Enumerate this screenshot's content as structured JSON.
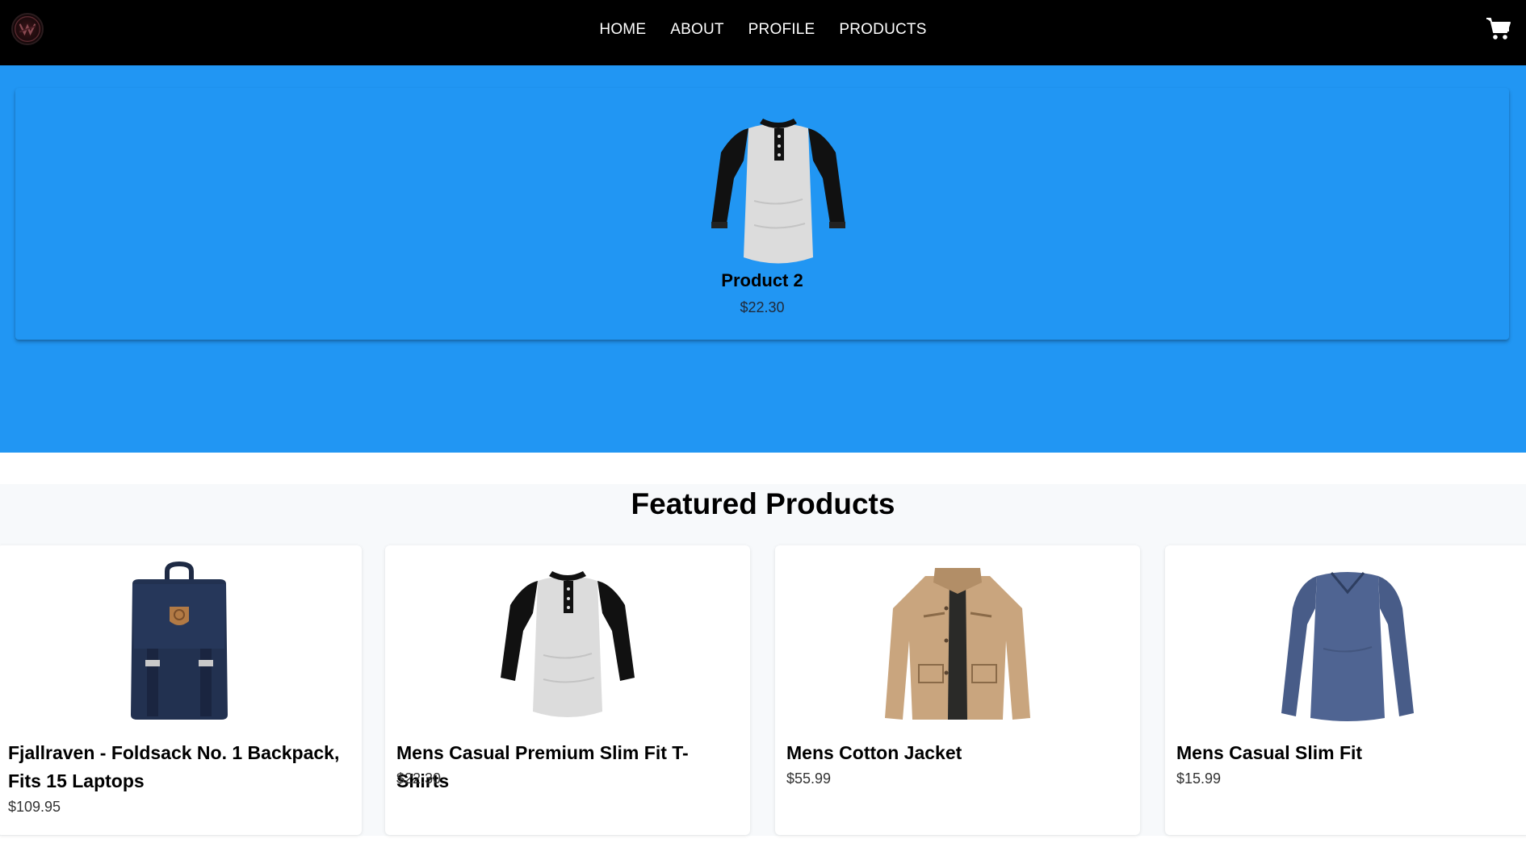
{
  "nav": {
    "logo_icon": "brand-logo-icon",
    "links": [
      "HOME",
      "ABOUT",
      "PROFILE",
      "PRODUCTS"
    ],
    "cart_icon": "shopping-cart-icon"
  },
  "hero": {
    "title": "Product 2",
    "price": "$22.30",
    "image_icon": "raglan-henley-tshirt-image",
    "background": "#2196f3"
  },
  "featured": {
    "heading": "Featured Products",
    "products": [
      {
        "title": "Fjallraven - Foldsack No. 1 Backpack, Fits 15 Laptops",
        "price": "$109.95",
        "image": "navy-backpack-image"
      },
      {
        "title": "Mens Casual Premium Slim Fit T-Shirts",
        "price": "$22.30",
        "image": "raglan-henley-tshirt-image"
      },
      {
        "title": "Mens Cotton Jacket",
        "price": "$55.99",
        "image": "khaki-jacket-image"
      },
      {
        "title": "Mens Casual Slim Fit",
        "price": "$15.99",
        "image": "blue-long-sleeve-shirt-image"
      }
    ]
  },
  "colors": {
    "navbar": "#000000",
    "hero": "#2196f3",
    "card": "#ffffff"
  }
}
